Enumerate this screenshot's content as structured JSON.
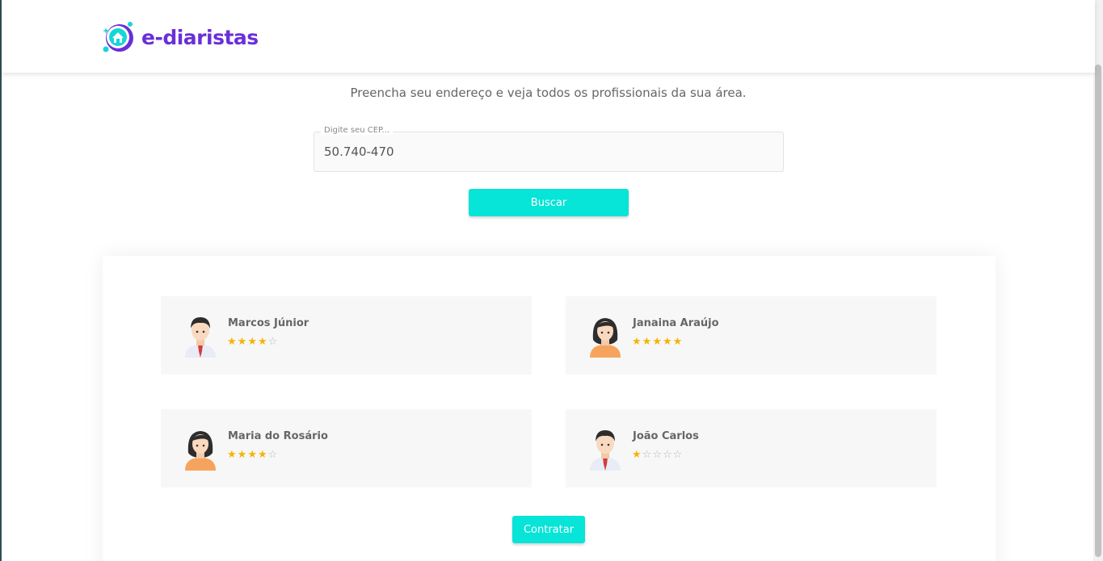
{
  "header": {
    "brand": "e-diaristas"
  },
  "search": {
    "subtitle": "Preencha seu endereço e veja todos os profissionais da sua área.",
    "cep_label": "Digite seu CEP...",
    "cep_value": "50.740-470",
    "submit_label": "Buscar"
  },
  "results": {
    "professionals": [
      {
        "name": "Marcos Júnior",
        "rating": 4,
        "max_rating": 5,
        "avatar": "male-avatar-icon"
      },
      {
        "name": "Janaina Araújo",
        "rating": 5,
        "max_rating": 5,
        "avatar": "female-avatar-icon"
      },
      {
        "name": "Maria do Rosário",
        "rating": 4,
        "max_rating": 5,
        "avatar": "female-avatar-icon"
      },
      {
        "name": "João Carlos",
        "rating": 1,
        "max_rating": 5,
        "avatar": "male-avatar-icon"
      }
    ],
    "hire_label": "Contratar"
  },
  "colors": {
    "brand": "#6a2fd8",
    "accent": "#07e4d8",
    "star": "#f5b400"
  }
}
